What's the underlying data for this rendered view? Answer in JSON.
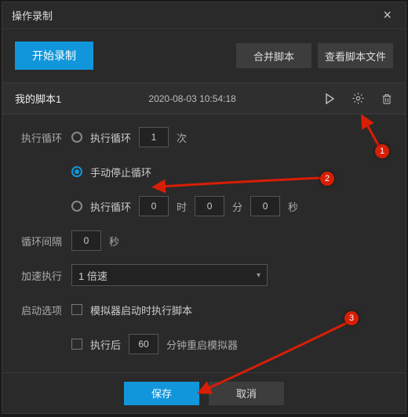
{
  "window": {
    "title": "操作录制"
  },
  "toolbar": {
    "start_record": "开始录制",
    "merge_script": "合并脚本",
    "view_script_file": "查看脚本文件"
  },
  "script": {
    "name": "我的脚本1",
    "timestamp": "2020-08-03 10:54:18"
  },
  "form": {
    "loop_group_label": "执行循环",
    "loop_count": {
      "label": "执行循环",
      "value": "1",
      "suffix": "次",
      "checked": false
    },
    "loop_manual": {
      "label": "手动停止循环",
      "checked": true
    },
    "loop_duration": {
      "label": "执行循环",
      "checked": false,
      "h": "0",
      "h_suffix": "时",
      "m": "0",
      "m_suffix": "分",
      "s": "0",
      "s_suffix": "秒"
    },
    "interval": {
      "label": "循环间隔",
      "value": "0",
      "suffix": "秒"
    },
    "speed": {
      "label": "加速执行",
      "selected": "1 倍速"
    },
    "startup": {
      "label": "启动选项",
      "run_on_emulator_start": {
        "label": "模拟器启动时执行脚本",
        "checked": false
      },
      "restart_after": {
        "label_pre": "执行后",
        "value": "60",
        "label_post": "分钟重启模拟器",
        "checked": false
      }
    }
  },
  "footer": {
    "save": "保存",
    "cancel": "取消"
  },
  "annotations": {
    "1": "1",
    "2": "2",
    "3": "3"
  },
  "colors": {
    "accent": "#1296db",
    "annotation": "#d81e06"
  }
}
